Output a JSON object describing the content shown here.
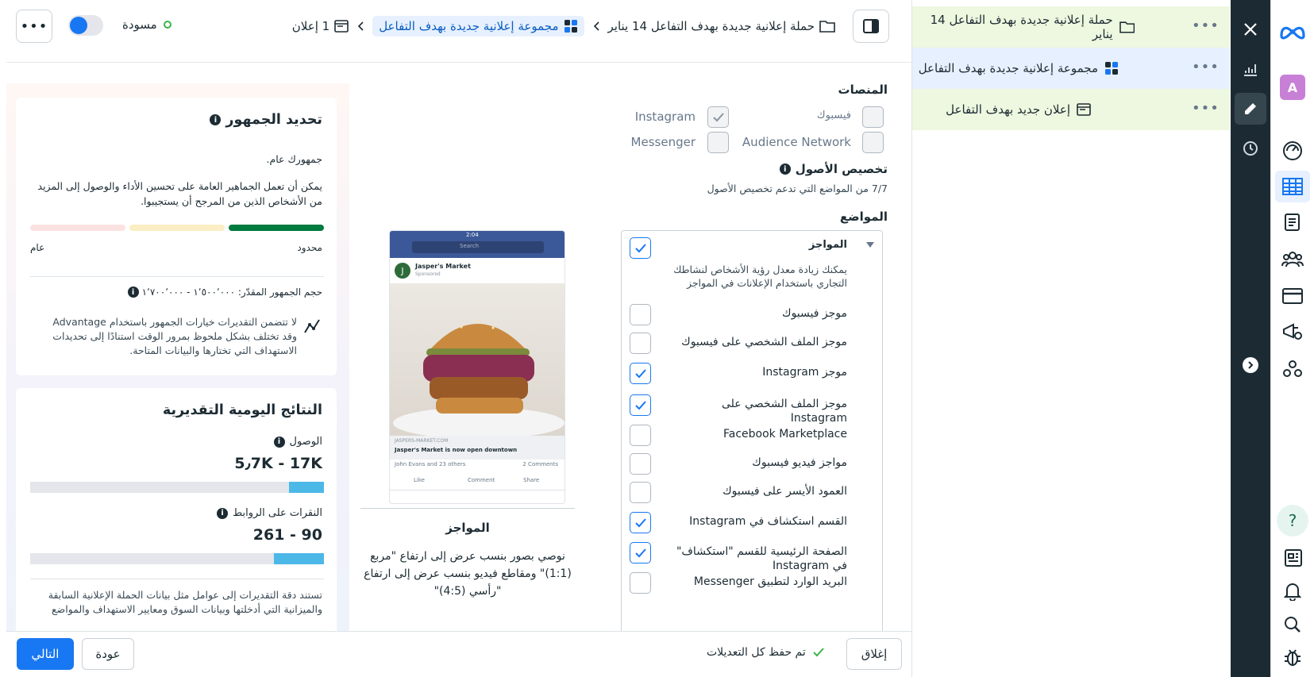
{
  "header": {
    "breadcrumb_campaign": "حملة إعلانية جديدة بهدف التفاعل 14 يناير",
    "breadcrumb_adset": "مجموعة إعلانية جديدة بهدف التفاعل",
    "breadcrumb_ad": "1 إعلان",
    "status": "مسودة"
  },
  "tree": {
    "campaign": "حملة إعلانية جديدة بهدف التفاعل 14 يناير",
    "adset": "مجموعة إعلانية جديدة بهدف التفاعل",
    "ad": "إعلان جديد بهدف التفاعل",
    "more": "•••"
  },
  "rail": {
    "avatar_letter": "A",
    "help": "?"
  },
  "audience_card": {
    "title": "تحديد الجمهور",
    "subtitle": "جمهورك عام.",
    "description": "يمكن أن تعمل الجماهير العامة على تحسين الأداء والوصول إلى المزيد من الأشخاص الذين من المرجح أن يستجيبوا.",
    "label_narrow": "محدود",
    "label_broad": "عام",
    "size_label": "حجم الجمهور المقدّر: ١٬٥٠٠٬٠٠٠ - ١٬٧٠٠٬٠٠٠",
    "advantage_note": "لا تتضمن التقديرات خيارات الجمهور باستخدام Advantage وقد تختلف بشكل ملحوظ بمرور الوقت استنادًا إلى تحديدات الاستهداف التي تختارها والبيانات المتاحة."
  },
  "results_card": {
    "title": "النتائج اليومية التقديرية",
    "reach_label": "الوصول",
    "reach_value": "5٫7K - 17K",
    "reach_fill": 0.12,
    "clicks_label": "النقرات على الروابط",
    "clicks_value": "261 - 90",
    "clicks_fill": 0.17,
    "footnote": "تستند دقة التقديرات إلى عوامل مثل بيانات الحملة الإعلانية السابقة والميزانية التي أدخلتها وبيانات السوق ومعايير الاستهداف والمواضع"
  },
  "platforms": {
    "title": "المنصات",
    "items": [
      {
        "label": "فيسبوك",
        "checked": false,
        "gray": true
      },
      {
        "label": "Instagram",
        "checked": true,
        "gray": true
      },
      {
        "label": "Audience Network",
        "checked": false,
        "gray": true
      },
      {
        "label": "Messenger",
        "checked": false,
        "gray": true
      }
    ]
  },
  "asset_customization": {
    "title": "تخصيص الأصول",
    "subtitle": "7/7 من المواضع التي تدعم تخصيص الأصول"
  },
  "placements": {
    "title": "المواضع",
    "group_title": "المواجز",
    "group_desc": "يمكنك زيادة معدل رؤية الأشخاص لنشاطك التجاري باستخدام الإعلانات في المواجز",
    "items": [
      {
        "label": "موجز فيسبوك",
        "checked": false
      },
      {
        "label": "موجز الملف الشخصي على فيسبوك",
        "checked": false
      },
      {
        "label": "موجز Instagram",
        "checked": true
      },
      {
        "label": "موجز الملف الشخصي على Instagram",
        "checked": true
      },
      {
        "label": "Facebook Marketplace",
        "checked": false
      },
      {
        "label": "مواجز فيديو فيسبوك",
        "checked": false
      },
      {
        "label": "العمود الأيسر على فيسبوك",
        "checked": false
      },
      {
        "label": "القسم استكشاف في Instagram",
        "checked": true
      },
      {
        "label": "الصفحة الرئيسية للقسم \"استكشاف\" في Instagram",
        "checked": true
      },
      {
        "label": "البريد الوارد لتطبيق Messenger",
        "checked": false
      }
    ]
  },
  "preview": {
    "time": "2:04",
    "search": "Search",
    "page_name": "Jasper's Market",
    "sponsored": "Sponsored",
    "link_domain": "JASPERS-MARKET.COM",
    "link_title": "Jasper's Market is now open downtown",
    "reactions": "John Evans and 23 others",
    "comments": "2 Comments",
    "like": "Like",
    "comment": "Comment",
    "share": "Share",
    "caption_title": "المواجز",
    "caption_text": "نوصي بصور بنسب عرض إلى ارتفاع \"مربع (1:1)\" ومقاطع فيديو بنسب عرض إلى ارتفاع \"رأسي (4:5)\""
  },
  "footer": {
    "close": "إغلاق",
    "saved": "تم حفظ كل التعديلات",
    "back": "عودة",
    "next": "التالي"
  },
  "colors": {
    "accent": "#1877f2",
    "dark": "#1c2b33",
    "good_green": "#007b3e",
    "tree_bg": "#eef7df"
  }
}
